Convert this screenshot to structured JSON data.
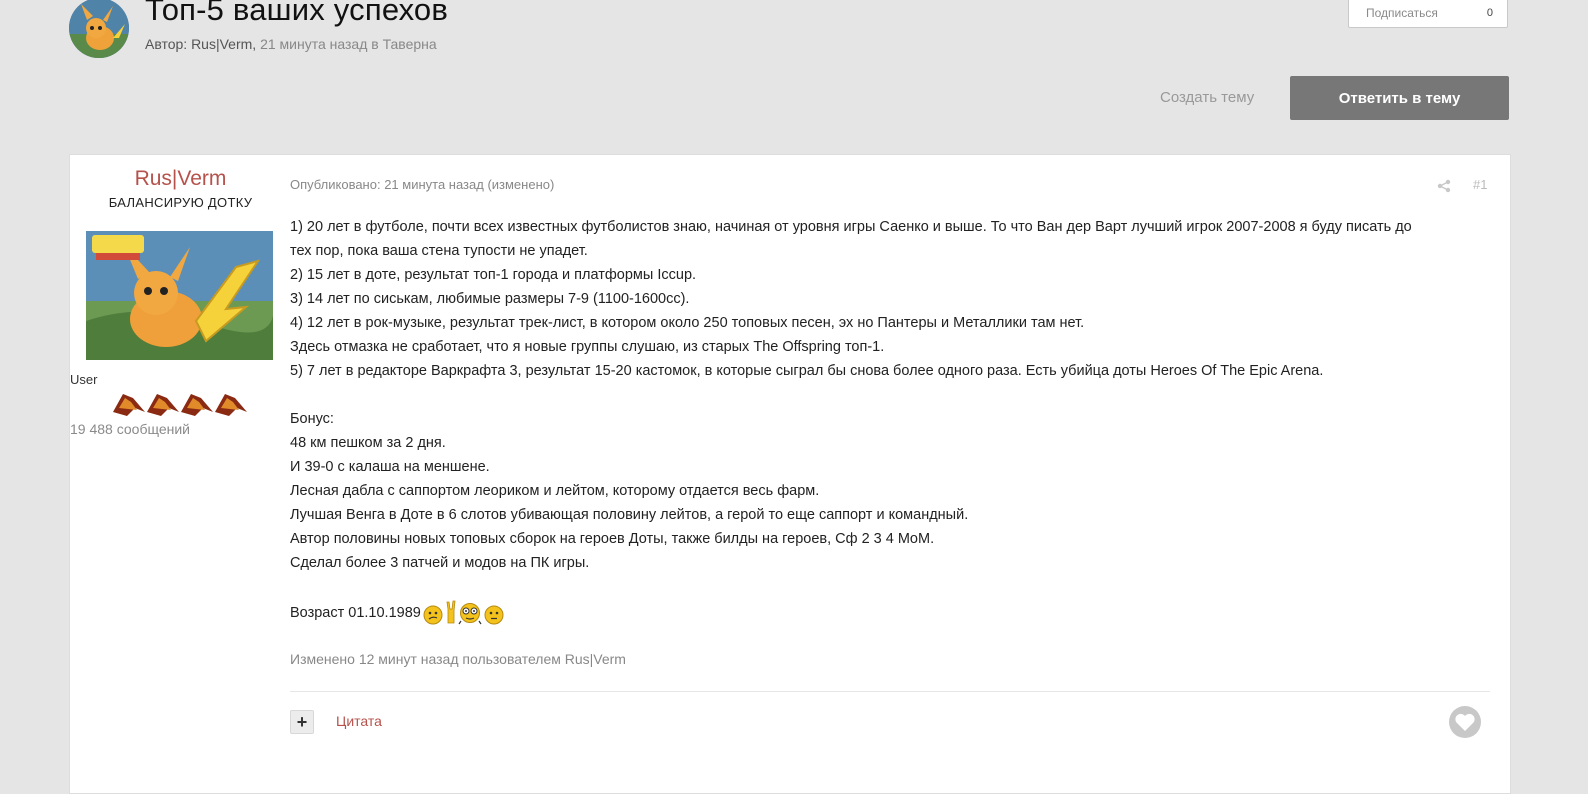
{
  "topic": {
    "title": "Топ-5 ваших успехов",
    "author_prefix": "Автор: Rus|Verm,",
    "time_forum": "21 минута назад в Таверна"
  },
  "follow": {
    "label": "Подписаться",
    "count": "0"
  },
  "actions": {
    "create_topic": "Создать тему",
    "reply": "Ответить в тему"
  },
  "post": {
    "author_name": "Rus|Verm",
    "author_title": "БАЛАНСИРУЮ ДОТКУ",
    "group": "User",
    "post_count": "19 488 сообщений",
    "posted": "Опубликовано: 21 минута назад (изменено)",
    "number": "#1",
    "lines": [
      "1) 20 лет в футболе, почти всех известных футболистов знаю, начиная от уровня игры Саенко и выше. То что Ван дер Варт лучший игрок 2007-2008 я буду писать до",
      "тех пор, пока ваша стена тупости не упадет.",
      "2) 15 лет в доте, результат топ-1 города и платформы Iccup.",
      "3) 14 лет по сиськам, любимые размеры 7-9 (1100-1600cc).",
      "4) 12 лет в рок-музыке, результат трек-лист, в котором около 250 топовых песен, эх но Пантеры и Металлики там нет.",
      "Здесь отмазка не сработает, что я новые группы слушаю, из старых The Offspring топ-1.",
      "5) 7 лет в редакторе Варкрафта 3, результат 15-20 кастомок, в которые сыграл бы снова более одного раза. Есть убийца доты Heroes Of The Epic Arena."
    ],
    "bonus_lines": [
      "Бонус:",
      "48 км пешком за 2 дня.",
      "И 39-0 с калаша на меншене.",
      "Лесная дабла с саппортом леориком и лейтом, которому отдается весь фарм.",
      "Лучшая Венга в Доте в 6 слотов убивающая половину лейтов, а герой то еще саппорт и командный.",
      "Автор половины новых топовых сборок на героев Доты, также билды на героев, Сф 2 3 4 MoM.",
      "Сделал более 3 патчей и модов на ПК игры."
    ],
    "age": "Возраст 01.10.1989",
    "edited": "Изменено 12 минут назад пользователем Rus|Verm",
    "quote": "Цитата",
    "plus": "+"
  },
  "icons": {
    "share": "share-icon",
    "like": "heart-icon",
    "emoticons": [
      "confused-emoticon",
      "rock-hand-emoticon",
      "nerd-emoticon",
      "neutral-emoticon"
    ]
  },
  "colors": {
    "accent": "#b5524b",
    "reply_button": "#777777",
    "background": "#e5e5e5"
  }
}
